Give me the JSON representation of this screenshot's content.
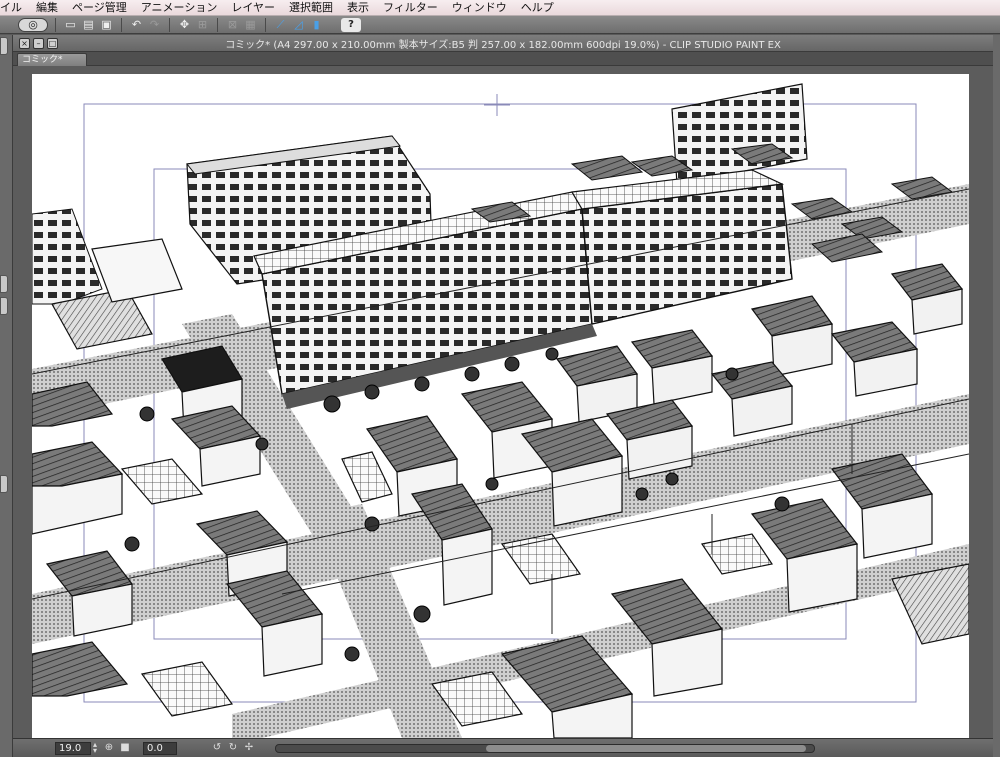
{
  "menubar": {
    "items": [
      "イル",
      "編集",
      "ページ管理",
      "アニメーション",
      "レイヤー",
      "選択範囲",
      "表示",
      "フィルター",
      "ウィンドウ",
      "ヘルプ"
    ]
  },
  "toolbar": {
    "icons": [
      "app-logo-icon",
      "new-file-icon",
      "open-file-icon",
      "save-icon",
      "undo-icon",
      "redo-icon",
      "transform-icon",
      "select-all-icon",
      "deselect-icon",
      "fill-icon",
      "snap-ruler-icon",
      "snap-special-ruler-icon",
      "snap-grid-icon",
      "help-icon"
    ],
    "help_label": "?"
  },
  "window": {
    "title": "コミック* (A4 297.00 x 210.00mm 製本サイズ:B5 判 257.00 x 182.00mm 600dpi 19.0%)  - CLIP STUDIO PAINT EX",
    "tab_label": "コミック*",
    "close_label": "×",
    "minimize_label": "–",
    "maximize_label": "□"
  },
  "statusbar": {
    "zoom": "19.0",
    "angle": "0.0"
  },
  "colors": {
    "menubar_bg": "#f2e6e9",
    "chrome_bg": "#6e6e6e",
    "canvas_bg": "#5c5c5c",
    "paper": "#ffffff",
    "guide_line": "#8a8ab8"
  }
}
